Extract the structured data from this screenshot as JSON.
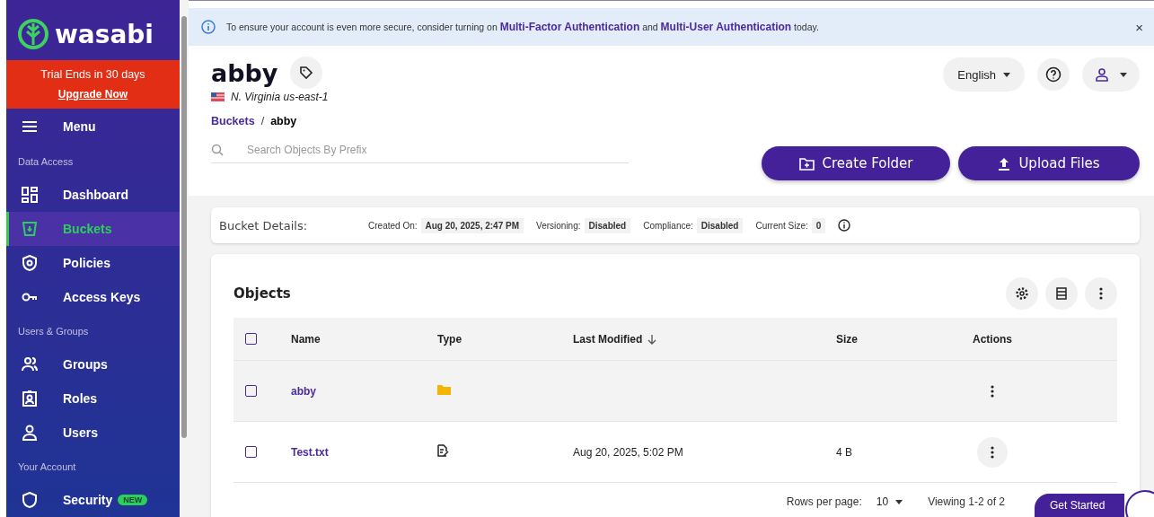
{
  "sidebar": {
    "logo": "wasabi",
    "trial": {
      "text": "Trial Ends in 30 days",
      "link": "Upgrade Now"
    },
    "menu": "Menu",
    "sections": [
      {
        "heading": "Data Access",
        "items": [
          {
            "label": "Dashboard",
            "selected": false
          },
          {
            "label": "Buckets",
            "selected": true
          },
          {
            "label": "Policies",
            "selected": false
          },
          {
            "label": "Access Keys",
            "selected": false
          }
        ]
      },
      {
        "heading": "Users & Groups",
        "items": [
          {
            "label": "Groups",
            "selected": false
          },
          {
            "label": "Roles",
            "selected": false
          },
          {
            "label": "Users",
            "selected": false
          }
        ]
      },
      {
        "heading": "Your Account",
        "items": [
          {
            "label": "Security",
            "selected": false,
            "badge": "NEW"
          }
        ]
      }
    ]
  },
  "banner": {
    "text": "To ensure your account is even more secure, consider turning on **Multi-Factor Authentication** and **Multi-User Authentication** today.",
    "close": "×"
  },
  "header": {
    "title": "abby",
    "region": "N. Virginia us-east-1",
    "breadcrumb": [
      "Buckets",
      "abby"
    ],
    "breadcrumb_separator": "/",
    "search": {
      "placeholder": "Search Objects By Prefix"
    },
    "language": "English",
    "buttons": [
      "Create Folder",
      "Upload Files"
    ]
  },
  "bucket_details": {
    "title": "Bucket Details:",
    "fields": [
      {
        "label": "Created On:",
        "value": "Aug 20, 2025, 2:47 PM"
      },
      {
        "label": "Versioning:",
        "value": "Disabled"
      },
      {
        "label": "Compliance:",
        "value": "Disabled"
      },
      {
        "label": "Current Size:",
        "value": "0"
      }
    ]
  },
  "objects": {
    "title": "Objects",
    "select_all_checked": false,
    "columns": [
      "Name",
      "Type",
      "Last Modified",
      "Size",
      "Actions"
    ],
    "rows": [
      {
        "name": "abby",
        "kind": "folder",
        "checked": false,
        "hovered": true
      },
      {
        "name": "Test.txt",
        "kind": "file",
        "modified": "Aug 20, 2025, 5:02 PM",
        "size": "4 B",
        "checked": false,
        "hovered": false
      }
    ],
    "rows_per_page_label": "Rows per page:",
    "rows_per_page": "10",
    "viewing": "Viewing 1-2 of 2"
  },
  "get_started": "Get Started"
}
